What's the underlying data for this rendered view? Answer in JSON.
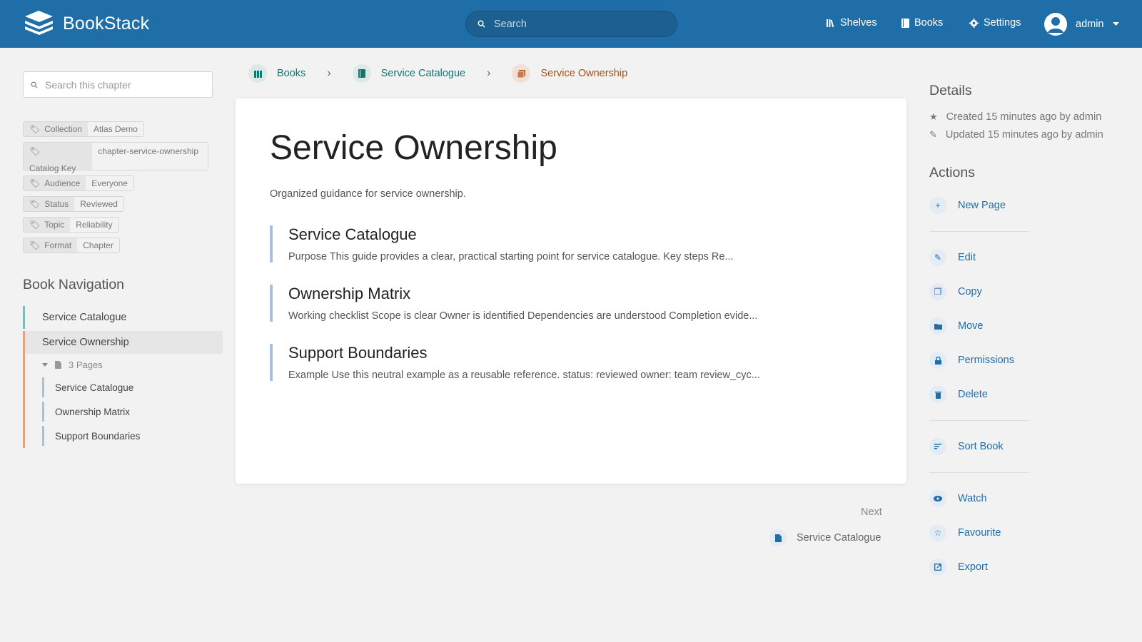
{
  "header": {
    "app_name": "BookStack",
    "search_placeholder": "Search",
    "nav": {
      "shelves": "Shelves",
      "books": "Books",
      "settings": "Settings"
    },
    "user": "admin"
  },
  "sidebar": {
    "search_placeholder": "Search this chapter",
    "tags": [
      {
        "name": "Collection",
        "value": "Atlas Demo"
      },
      {
        "name": "Catalog Key",
        "value": "chapter-service-ownership"
      },
      {
        "name": "Audience",
        "value": "Everyone"
      },
      {
        "name": "Status",
        "value": "Reviewed"
      },
      {
        "name": "Topic",
        "value": "Reliability"
      },
      {
        "name": "Format",
        "value": "Chapter"
      }
    ],
    "book_nav_title": "Book Navigation",
    "book_nav": {
      "chapter_1": "Service Catalogue",
      "chapter_2": "Service Ownership",
      "pages_toggle": "3 Pages",
      "pages": [
        "Service Catalogue",
        "Ownership Matrix",
        "Support Boundaries"
      ]
    }
  },
  "breadcrumb": {
    "books": "Books",
    "book": "Service Catalogue",
    "chapter": "Service Ownership"
  },
  "chapter": {
    "title": "Service Ownership",
    "description": "Organized guidance for service ownership.",
    "entries": [
      {
        "title": "Service Catalogue",
        "excerpt": "Purpose This guide provides a clear, practical starting point for service catalogue. Key steps Re..."
      },
      {
        "title": "Ownership Matrix",
        "excerpt": "Working checklist Scope is clear Owner is identified Dependencies are understood Completion evide..."
      },
      {
        "title": "Support Boundaries",
        "excerpt": "Example Use this neutral example as a reusable reference. status: reviewed owner: team review_cyc..."
      }
    ]
  },
  "next": {
    "label": "Next",
    "title": "Service Catalogue"
  },
  "details": {
    "title": "Details",
    "created": "Created 15 minutes ago by admin",
    "updated": "Updated 15 minutes ago by admin"
  },
  "actions": {
    "title": "Actions",
    "new_page": "New Page",
    "edit": "Edit",
    "copy": "Copy",
    "move": "Move",
    "permissions": "Permissions",
    "delete": "Delete",
    "sort_book": "Sort Book",
    "watch": "Watch",
    "favourite": "Favourite",
    "export": "Export"
  },
  "colors": {
    "header": "#206ea7",
    "book": "#077b70",
    "chapter": "#af4d0d",
    "page": "#206ea7"
  }
}
